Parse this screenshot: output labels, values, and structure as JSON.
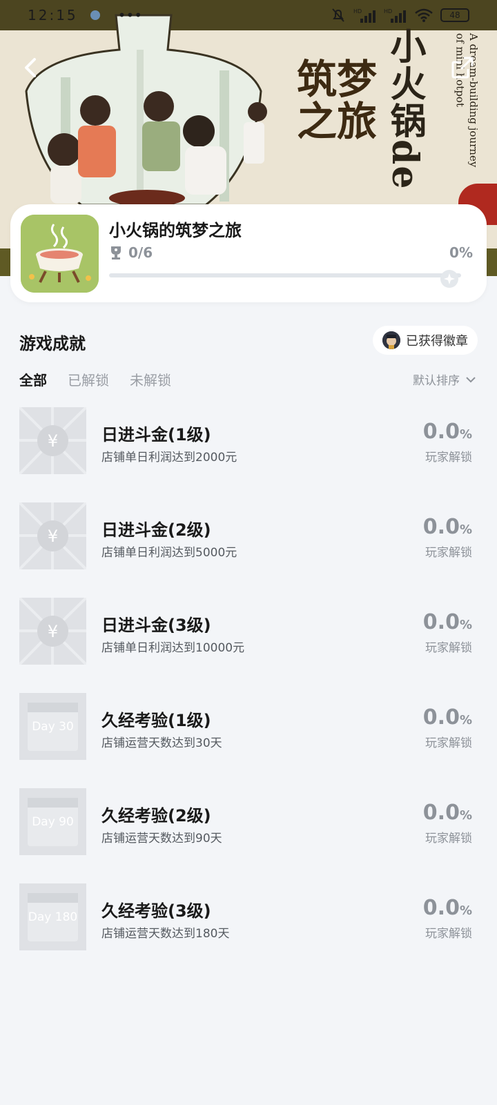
{
  "status_bar": {
    "time": "12:15",
    "dots": "•••",
    "battery": "48"
  },
  "banner": {
    "title_vertical": "小火锅de",
    "title_script": "筑梦之旅",
    "subtitle_en": "A dream-building journey of mini hotpot"
  },
  "game": {
    "title": "小火锅的筑梦之旅",
    "achievements_count": "0/6",
    "progress_label": "0%",
    "progress_value": 0
  },
  "section": {
    "title": "游戏成就",
    "badge_button_label": "已获得徽章",
    "tabs": [
      {
        "label": "全部",
        "active": true
      },
      {
        "label": "已解锁",
        "active": false
      },
      {
        "label": "未解锁",
        "active": false
      }
    ],
    "sort_label": "默认排序"
  },
  "achievements": [
    {
      "name": "日进斗金(1级)",
      "desc": "店铺单日利润达到2000元",
      "rate": "0.0",
      "pct": "%",
      "unlock_label": "玩家解锁",
      "icon": "yen-coin-icon",
      "thumb_text": "¥"
    },
    {
      "name": "日进斗金(2级)",
      "desc": "店铺单日利润达到5000元",
      "rate": "0.0",
      "pct": "%",
      "unlock_label": "玩家解锁",
      "icon": "yen-coin-icon",
      "thumb_text": "¥"
    },
    {
      "name": "日进斗金(3级)",
      "desc": "店铺单日利润达到10000元",
      "rate": "0.0",
      "pct": "%",
      "unlock_label": "玩家解锁",
      "icon": "yen-coin-icon",
      "thumb_text": "¥"
    },
    {
      "name": "久经考验(1级)",
      "desc": "店铺运营天数达到30天",
      "rate": "0.0",
      "pct": "%",
      "unlock_label": "玩家解锁",
      "icon": "calendar-icon",
      "thumb_text": "Day  30"
    },
    {
      "name": "久经考验(2级)",
      "desc": "店铺运营天数达到90天",
      "rate": "0.0",
      "pct": "%",
      "unlock_label": "玩家解锁",
      "icon": "calendar-icon",
      "thumb_text": "Day  90"
    },
    {
      "name": "久经考验(3级)",
      "desc": "店铺运营天数达到180天",
      "rate": "0.0",
      "pct": "%",
      "unlock_label": "玩家解锁",
      "icon": "calendar-icon",
      "thumb_text": "Day 180"
    }
  ],
  "colors": {
    "banner_band": "#4c4520",
    "icon_bg": "#a8c466",
    "muted": "#8d9299"
  }
}
